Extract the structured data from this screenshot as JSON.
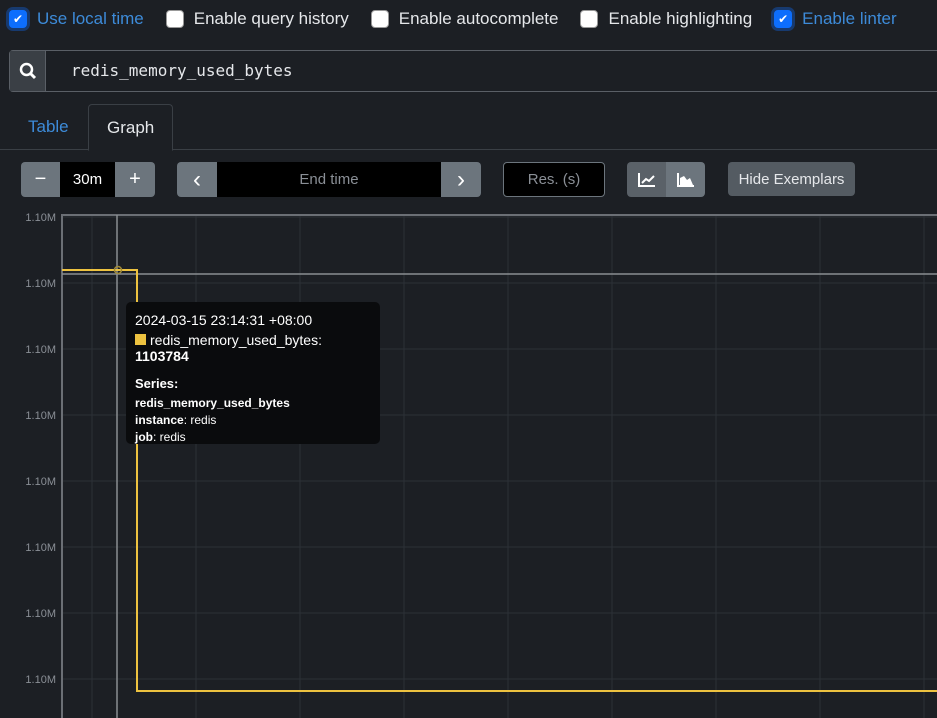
{
  "options": [
    {
      "label": "Use local time",
      "checked": true
    },
    {
      "label": "Enable query history",
      "checked": false
    },
    {
      "label": "Enable autocomplete",
      "checked": false
    },
    {
      "label": "Enable highlighting",
      "checked": false
    },
    {
      "label": "Enable linter",
      "checked": true
    }
  ],
  "search": {
    "icon": "search-icon",
    "query": "redis_memory_used_bytes"
  },
  "tabs": [
    {
      "label": "Table",
      "active": false
    },
    {
      "label": "Graph",
      "active": true
    }
  ],
  "controls": {
    "range": "30m",
    "minus": "−",
    "plus": "+",
    "end_time_placeholder": "End time",
    "resolution_placeholder": "Res. (s)",
    "hide_exemplars": "Hide Exemplars",
    "prev": "‹",
    "next": "›",
    "stacked": true
  },
  "tooltip": {
    "timestamp": "2024-03-15 23:14:31 +08:00",
    "series_name": "redis_memory_used_bytes",
    "value": "1103784",
    "series_heading": "Series:",
    "labels_title": "redis_memory_used_bytes",
    "instance_key": "instance",
    "instance_val": "redis",
    "job_key": "job",
    "job_val": "redis"
  },
  "chart_data": {
    "type": "line",
    "y_tick_labels": [
      "1.10M",
      "1.10M",
      "1.10M",
      "1.10M",
      "1.10M",
      "1.10M",
      "1.10M",
      "1.10M"
    ],
    "series": [
      {
        "name": "redis_memory_used_bytes",
        "color": "#edc240",
        "values_description_free": true,
        "points": [
          {
            "x": "2024-03-15 23:14:31 +08:00",
            "y": 1103784
          }
        ]
      }
    ],
    "grid": true
  }
}
